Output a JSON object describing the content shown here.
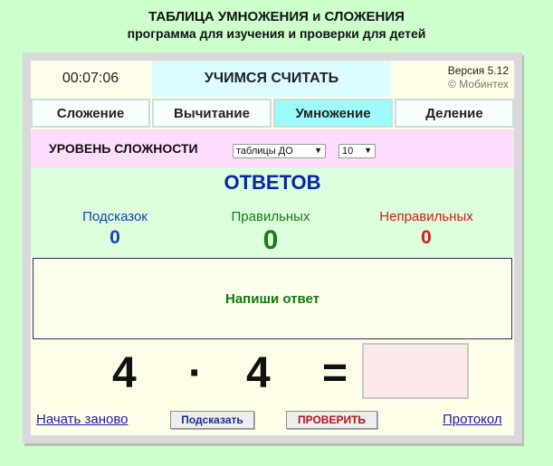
{
  "header": {
    "title": "ТАБЛИЦА УМНОЖЕНИЯ и СЛОЖЕНИЯ",
    "subtitle": "программа для изучения и проверки для детей"
  },
  "topbar": {
    "timer": "00:07:06",
    "title": "УЧИМСЯ СЧИТАТЬ",
    "version": "Версия 5.12",
    "copyright": "© Мобинтех"
  },
  "tabs": [
    {
      "label": "Сложение",
      "active": false
    },
    {
      "label": "Вычитание",
      "active": false
    },
    {
      "label": "Умножение",
      "active": true
    },
    {
      "label": "Деление",
      "active": false
    }
  ],
  "level": {
    "label": "УРОВЕНЬ СЛОЖНОСТИ",
    "mode_value": "таблицы ДО",
    "number_value": "10"
  },
  "answers": {
    "title": "ОТВЕТОВ",
    "hints_label": "Подсказок",
    "hints_value": "0",
    "correct_label": "Правильных",
    "correct_value": "0",
    "wrong_label": "Неправильных",
    "wrong_value": "0"
  },
  "message": "Напиши ответ",
  "equation": {
    "operand1": "4",
    "operator": "·",
    "operand2": "4",
    "equals": "=",
    "answer": ""
  },
  "footer": {
    "restart_link": "Начать заново",
    "hint_button": "Подсказать",
    "check_button": "ПРОВЕРИТЬ",
    "log_link": "Протокол"
  },
  "colors": {
    "page_background": "#ccffcc",
    "active_tab": "#9ef9fb",
    "hints_color": "#1a3fb5",
    "correct_color": "#1a7a1a",
    "wrong_color": "#d21c1c"
  }
}
